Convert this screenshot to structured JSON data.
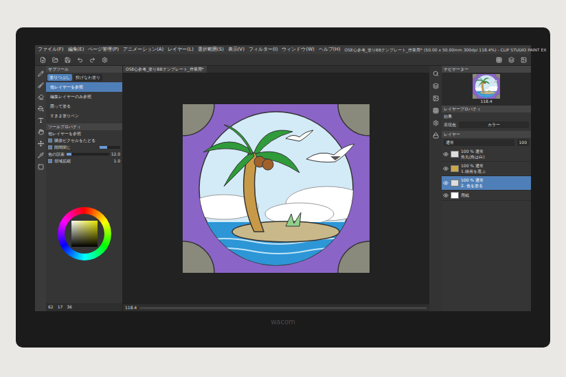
{
  "window": {
    "title": "OSE心参考_塗りBBテンプレート_作業用* (50.00 x 50.00mm 300dpi 118.4%) - CLIP STUDIO PAINT EX"
  },
  "menu": [
    "ファイル(F)",
    "編集(E)",
    "ページ管理(P)",
    "アニメーション(A)",
    "レイヤー(L)",
    "選択範囲(S)",
    "表示(V)",
    "フィルター(I)",
    "ウィンドウ(W)",
    "ヘルプ(H)"
  ],
  "canvas": {
    "tab": "OSE心参考_塗りBBテンプレート_作業用*",
    "zoom": "118.4"
  },
  "subtool": {
    "title": "サブツール",
    "tabs": [
      {
        "label": "塗りつぶし",
        "selected": true
      },
      {
        "label": "投げなわ塗り",
        "selected": false
      }
    ],
    "items": [
      {
        "label": "他レイヤーを参照",
        "selected": true
      },
      {
        "label": "編集レイヤーのみ参照",
        "selected": false
      },
      {
        "label": "囲って塗る",
        "selected": false
      },
      {
        "label": "すきま塗りペン",
        "selected": false
      }
    ]
  },
  "tool_property": {
    "title": "ツールプロパティ",
    "tool": "他レイヤーを参照",
    "rows": [
      {
        "label": "隣接ピクセルをたどる",
        "kind": "checkbox",
        "checked": true
      },
      {
        "label": "隙間閉じ",
        "kind": "gap",
        "checked": true,
        "level": 0.35
      },
      {
        "label": "色の誤差",
        "kind": "slider",
        "reading": "12.0",
        "level": 0.12
      },
      {
        "label": "領域拡縮",
        "kind": "number",
        "checked": true,
        "reading": "1.0"
      }
    ]
  },
  "status_bar": [
    "62",
    "17",
    "36"
  ],
  "navigator": {
    "title": "ナビゲーター",
    "zoom": "118.4"
  },
  "layer_property": {
    "title": "レイヤープロパティ",
    "effect": "効果",
    "color_label": "表現色",
    "color_value": "カラー"
  },
  "layers": {
    "title": "レイヤー",
    "blend": "通常",
    "opacity": "100",
    "items": [
      {
        "mode": "100 % 通常",
        "name": "角丸(角は白)",
        "selected": false,
        "kind": "layer"
      },
      {
        "mode": "100 % 通常",
        "name": "1.線画を選ぶ",
        "selected": false,
        "kind": "folder"
      },
      {
        "mode": "100 % 通常",
        "name": "2. 色を塗る",
        "selected": true,
        "kind": "layer"
      },
      {
        "mode": "",
        "name": "用紙",
        "selected": false,
        "kind": "paper"
      }
    ]
  },
  "bezel": {
    "brand": "wacom"
  }
}
